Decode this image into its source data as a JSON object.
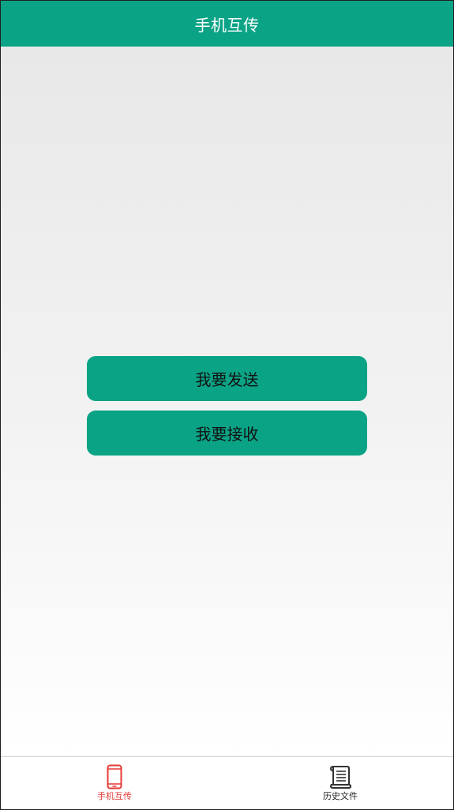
{
  "app_bar": {
    "title": "手机互传"
  },
  "main": {
    "send_label": "我要发送",
    "receive_label": "我要接收"
  },
  "bottom_nav": {
    "items": [
      {
        "label": "手机互传",
        "icon": "phone-icon",
        "active": true,
        "color": "#e53935"
      },
      {
        "label": "历史文件",
        "icon": "scroll-document-icon",
        "active": false,
        "color": "#222222"
      }
    ]
  },
  "colors": {
    "accent": "#0ba386"
  }
}
